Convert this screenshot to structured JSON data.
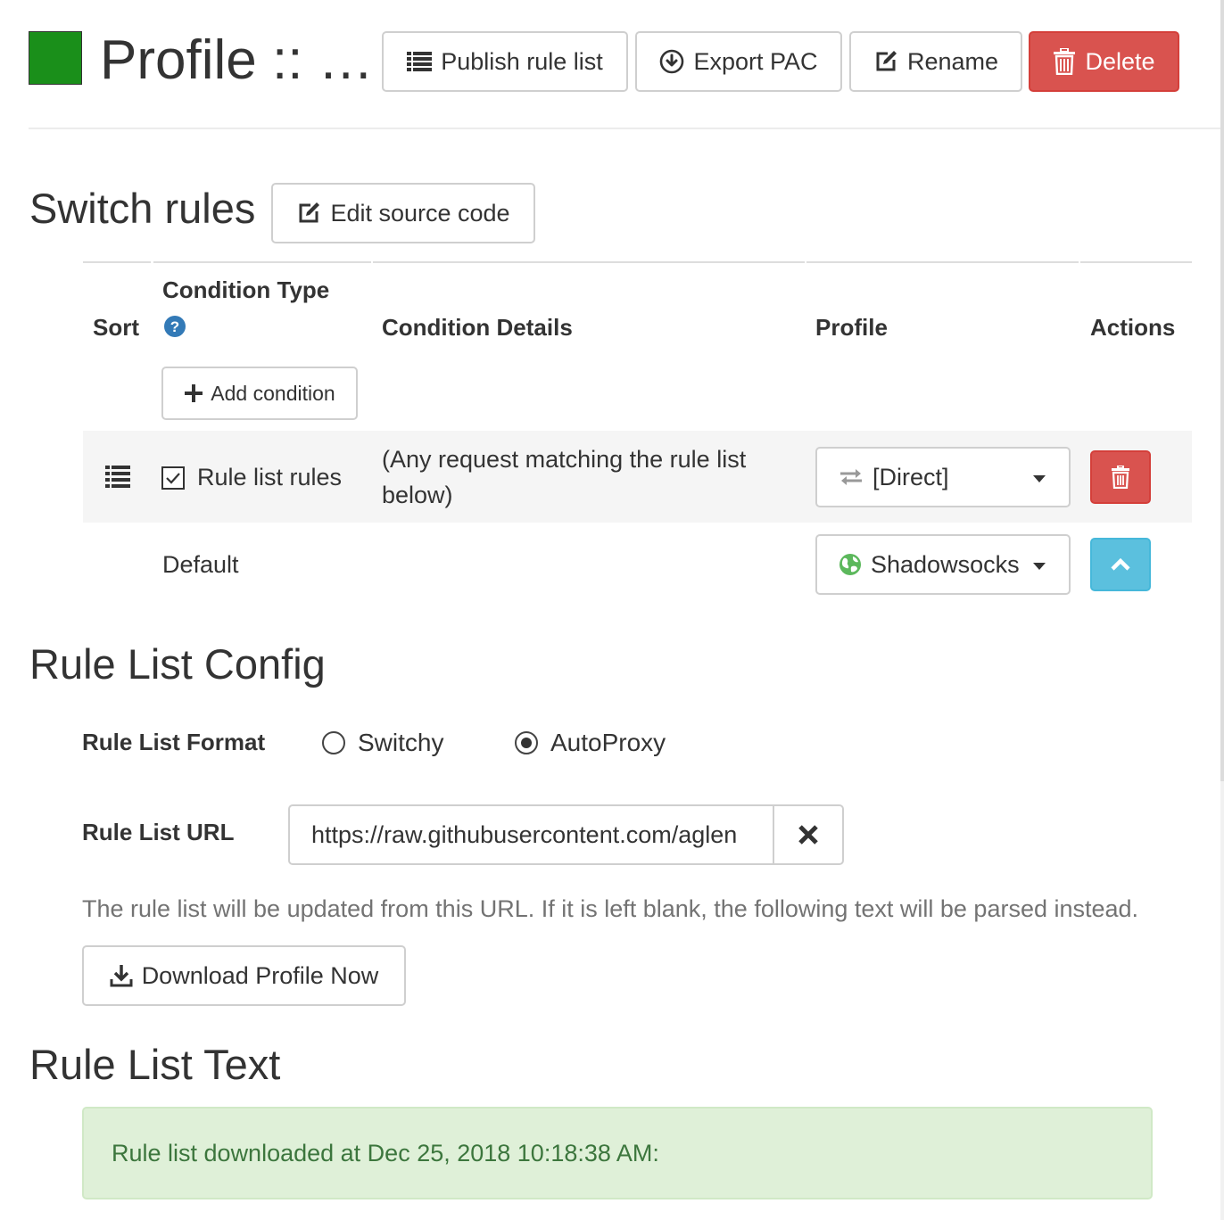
{
  "header": {
    "swatch_color": "#1a8f1a",
    "title": "Profile :: …",
    "publish_label": "Publish rule list",
    "export_label": "Export PAC",
    "rename_label": "Rename",
    "delete_label": "Delete"
  },
  "switch_rules": {
    "title": "Switch rules",
    "edit_source_label": "Edit source code",
    "columns": {
      "sort": "Sort",
      "condition_type": "Condition Type",
      "condition_details": "Condition Details",
      "profile": "Profile",
      "actions": "Actions"
    },
    "add_condition_label": "Add condition",
    "rule_row": {
      "condition_type": "Rule list rules",
      "details_line1": "(Any request matching the rule list",
      "details_line2": "below)",
      "profile": "[Direct]"
    },
    "default_row": {
      "label": "Default",
      "profile": "Shadowsocks"
    }
  },
  "rule_list_config": {
    "title": "Rule List Config",
    "format_label": "Rule List Format",
    "format_options": [
      "Switchy",
      "AutoProxy"
    ],
    "format_selected": "AutoProxy",
    "url_label": "Rule List URL",
    "url_value": "https://raw.githubusercontent.com/aglen",
    "help_text": "The rule list will be updated from this URL. If it is left blank, the following text will be parsed instead.",
    "download_label": "Download Profile Now"
  },
  "rule_list_text": {
    "title": "Rule List Text",
    "status": "Rule list downloaded at Dec 25, 2018 10:18:38 AM:"
  },
  "colors": {
    "danger": "#d9534f",
    "info": "#5bc0de",
    "success_bg": "#dff0d8",
    "success_text": "#3c763d",
    "help_icon": "#337ab7"
  }
}
